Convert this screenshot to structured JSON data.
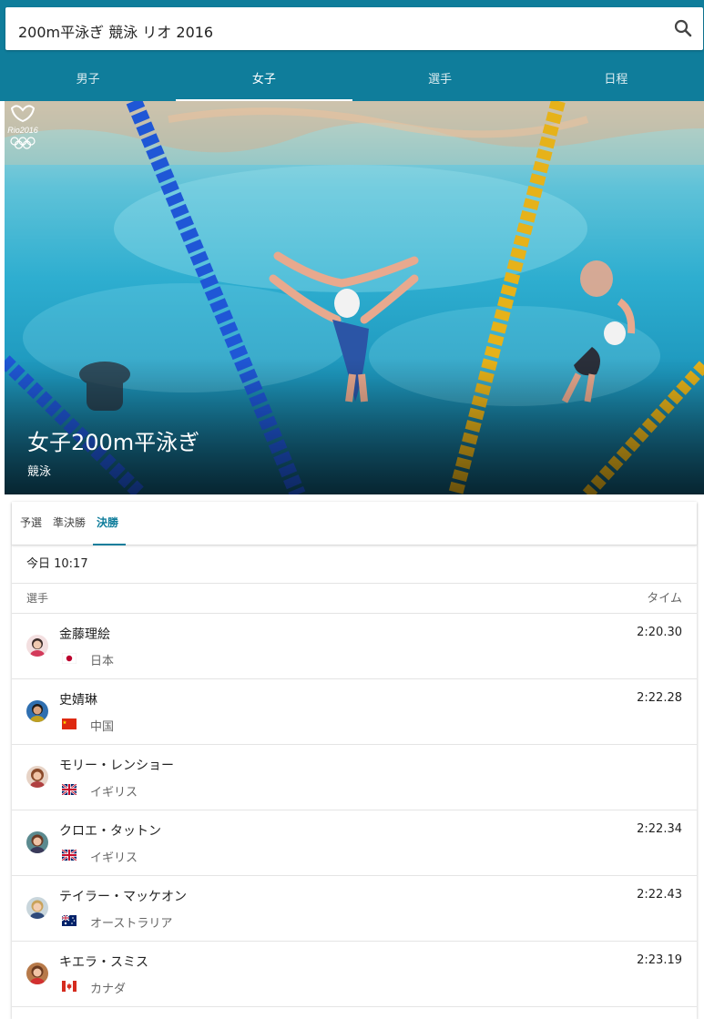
{
  "search": {
    "query": "200m平泳ぎ 競泳 リオ 2016",
    "icon": "search-icon"
  },
  "nav_tabs": [
    {
      "label": "男子",
      "active": false
    },
    {
      "label": "女子",
      "active": true
    },
    {
      "label": "選手",
      "active": false
    },
    {
      "label": "日程",
      "active": false
    }
  ],
  "hero": {
    "title": "女子200m平泳ぎ",
    "subtitle": "競泳"
  },
  "rounds": [
    {
      "label": "予選",
      "active": false
    },
    {
      "label": "準決勝",
      "active": false
    },
    {
      "label": "決勝",
      "active": true
    }
  ],
  "results": {
    "date": "今日 10:17",
    "col_athlete": "選手",
    "col_time": "タイム",
    "athletes": [
      {
        "name": "金藤理絵",
        "country": "日本",
        "time": "2:20.30",
        "flag": "japan-flag"
      },
      {
        "name": "史婧琳",
        "country": "中国",
        "time": "2:22.28",
        "flag": "china-flag"
      },
      {
        "name": "モリー・レンショー",
        "country": "イギリス",
        "time": "",
        "flag": "uk-flag"
      },
      {
        "name": "クロエ・タットン",
        "country": "イギリス",
        "time": "2:22.34",
        "flag": "uk-flag"
      },
      {
        "name": "テイラー・マッケオン",
        "country": "オーストラリア",
        "time": "2:22.43",
        "flag": "australia-flag"
      },
      {
        "name": "キエラ・スミス",
        "country": "カナダ",
        "time": "2:23.19",
        "flag": "canada-flag"
      }
    ]
  },
  "colors": {
    "brand": "#0f7d9b",
    "lane_blue": "#1f57d6",
    "lane_yellow": "#e6b21a"
  }
}
